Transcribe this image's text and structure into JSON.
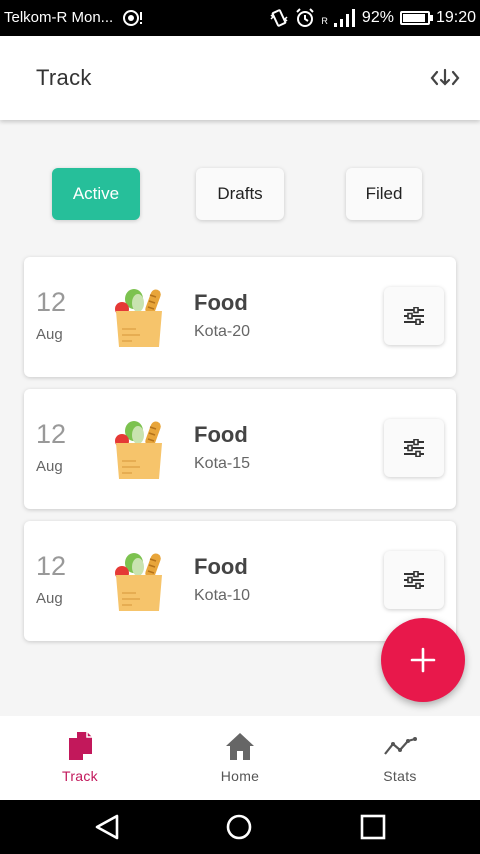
{
  "status_bar": {
    "carrier": "Telkom-R Mon...",
    "signal_label": "R",
    "battery": "92%",
    "battery_level": 0.92,
    "time": "19:20"
  },
  "app_bar": {
    "title": "Track",
    "sort_icon": "sort-arrows-icon"
  },
  "tabs": [
    {
      "label": "Active",
      "active": true
    },
    {
      "label": "Drafts",
      "active": false
    },
    {
      "label": "Filed",
      "active": false
    }
  ],
  "entries": [
    {
      "day": "12",
      "month": "Aug",
      "category": "Food",
      "subtitle": "Kota-20",
      "icon": "grocery-bag-icon"
    },
    {
      "day": "12",
      "month": "Aug",
      "category": "Food",
      "subtitle": "Kota-15",
      "icon": "grocery-bag-icon"
    },
    {
      "day": "12",
      "month": "Aug",
      "category": "Food",
      "subtitle": "Kota-10",
      "icon": "grocery-bag-icon"
    }
  ],
  "fab": {
    "icon": "plus-icon"
  },
  "bottom_nav": [
    {
      "label": "Track",
      "icon": "documents-icon",
      "active": true
    },
    {
      "label": "Home",
      "icon": "home-icon",
      "active": false
    },
    {
      "label": "Stats",
      "icon": "line-chart-icon",
      "active": false
    }
  ],
  "colors": {
    "accent": "#26bf9a",
    "fab": "#e8184b",
    "nav_active": "#c2185b"
  }
}
